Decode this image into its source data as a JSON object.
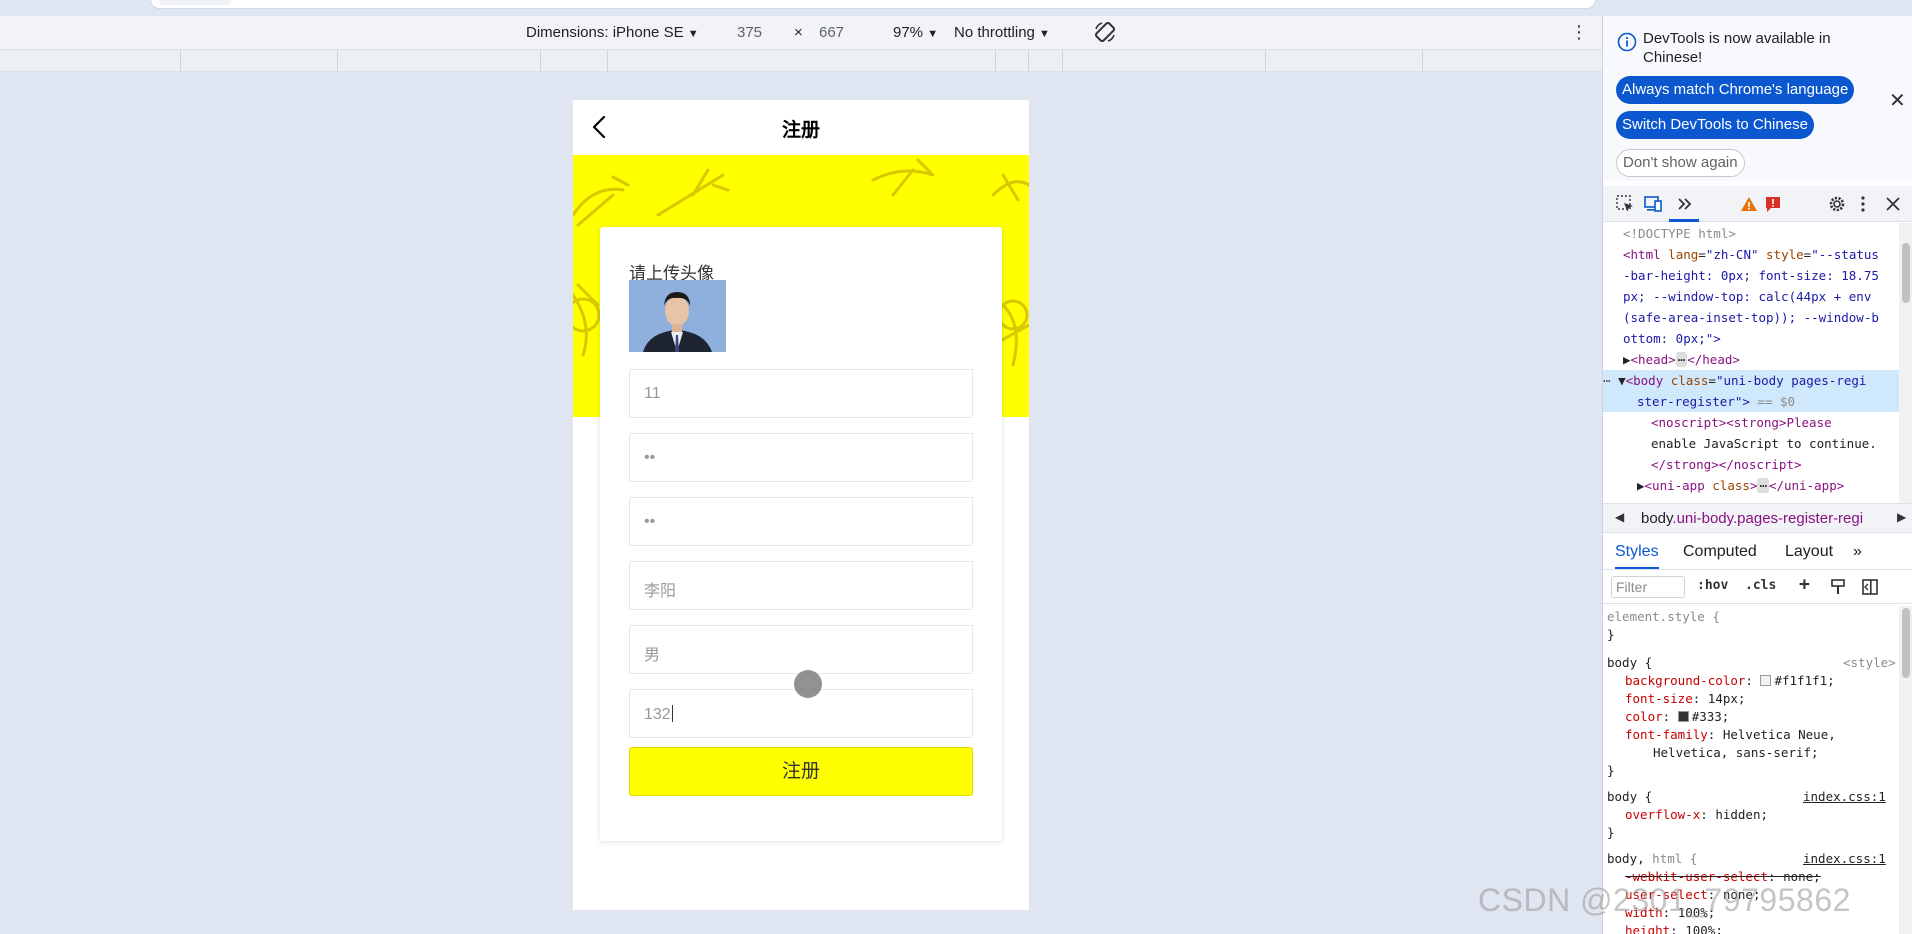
{
  "device_toolbar": {
    "dimensions_label": "Dimensions: iPhone SE",
    "width_value": "375",
    "times": "×",
    "height_value": "667",
    "zoom": "97%",
    "throttling": "No throttling"
  },
  "app": {
    "nav_title": "注册",
    "avatar_label": "请上传头像",
    "fields": [
      {
        "value": "11"
      },
      {
        "value": "••"
      },
      {
        "value": "••"
      },
      {
        "value": "李阳"
      },
      {
        "value": "男"
      },
      {
        "value": "132"
      }
    ],
    "submit_label": "注册",
    "colors": {
      "brand_yellow": "#ffff00"
    }
  },
  "devtools": {
    "info_banner": {
      "message": "DevTools is now available in Chinese!",
      "button_match": "Always match Chrome's language",
      "button_switch": "Switch DevTools to Chinese",
      "button_dismiss": "Don't show again"
    },
    "elements": {
      "doctype": "<!DOCTYPE html>",
      "html_open_1": "<html",
      "html_attr_lang": "lang",
      "html_val_lang": "\"zh-CN\"",
      "html_attr_style": "style",
      "html_val_style_1": "\"--status",
      "html_val_style_2": "-bar-height: 0px; font-size: 18.75",
      "html_val_style_3": "px; --window-top: calc(44px + env",
      "html_val_style_4": "(safe-area-inset-top)); --window-b",
      "html_val_style_5": "ottom: 0px;\">",
      "head": "<head>",
      "head_close": "</head>",
      "body_open": "<body",
      "body_attr": "class",
      "body_val_1": "\"uni-body pages-regi",
      "body_val_2": "ster-register\">",
      "body_eq": "== $0",
      "noscript_1": "<noscript><strong>Please",
      "noscript_2": "enable JavaScript to continue.",
      "noscript_3": "</strong></noscript>",
      "uniapp_open": "<uni-app",
      "uniapp_attr": "class",
      "uniapp_close": "</uni-app>"
    },
    "breadcrumb": {
      "tag": "body",
      "classes": ".uni-body.pages-register-regi"
    },
    "style_tabs": [
      "Styles",
      "Computed",
      "Layout"
    ],
    "filter_placeholder": "Filter",
    "filter_hov": ":hov",
    "filter_cls": ".cls",
    "rules": {
      "element_style": "element.style {",
      "close": "}",
      "body_sel": "body {",
      "body_src_1": "<style>",
      "bg_prop": "background-color",
      "bg_val": "#f1f1f1;",
      "fs_prop": "font-size",
      "fs_val": "14px;",
      "color_prop": "color",
      "color_val": "#333;",
      "ff_prop": "font-family",
      "ff_val_1": "Helvetica Neue,",
      "ff_val_2": "Helvetica, sans-serif;",
      "body_src_2": "index.css:1",
      "ox_prop": "overflow-x",
      "ox_val": "hidden;",
      "bh_sel_1": "body,",
      "bh_sel_2": "html {",
      "body_src_3": "index.css:1",
      "wus_prop": "-webkit-user-select",
      "wus_val": "none;",
      "us_prop": "user-select",
      "us_val": "none;",
      "w_prop": "width",
      "w_val": "100%;",
      "h_prop": "height",
      "h_val": "100%;"
    },
    "colors": {
      "accent": "#0b57d0",
      "bg_swatch": "#f1f1f1",
      "color_swatch": "#333333"
    }
  },
  "watermark": "CSDN @2301_79795862"
}
